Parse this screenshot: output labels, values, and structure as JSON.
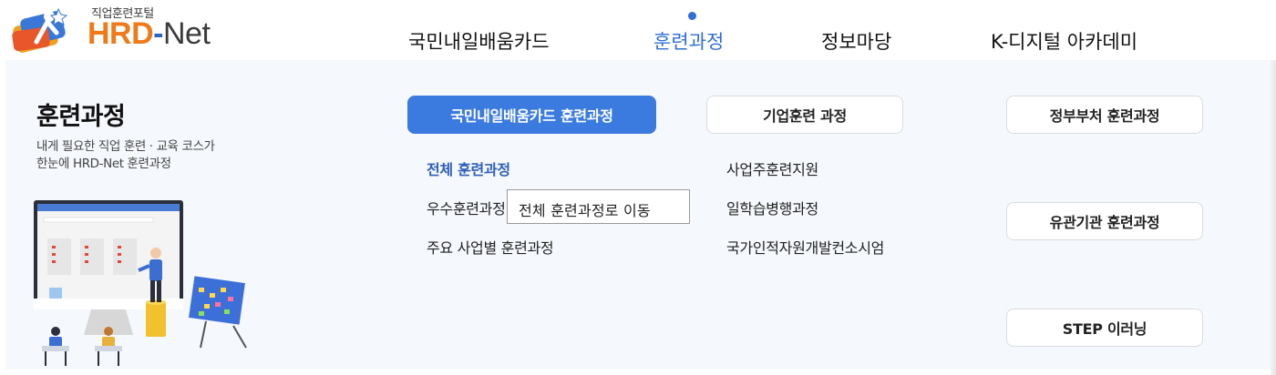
{
  "header": {
    "logo_sub": "직업훈련포털",
    "logo_hrd": "HRD",
    "logo_dash": "-",
    "logo_net": "Net",
    "nav": [
      {
        "label": "국민내일배움카드"
      },
      {
        "label": "훈련과정"
      },
      {
        "label": "정보마당"
      },
      {
        "label": "K-디지털 아카데미"
      }
    ]
  },
  "section": {
    "title": "훈련과정",
    "desc_line1": "내게 필요한 직업 훈련 · 교육 코스가",
    "desc_line2": "한눈에 HRD-Net 훈련과정"
  },
  "buttons": {
    "card_course": "국민내일배움카드 훈련과정",
    "company_course": "기업훈련 과정",
    "gov_course": "정부부처 훈련과정",
    "related_course": "유관기관 훈련과정",
    "step": "STEP 이러닝"
  },
  "links": {
    "all_courses": "전체 훈련과정",
    "excellent": "우수훈련과정",
    "major_business": "주요 사업별 훈련과정",
    "employer_support": "사업주훈련지원",
    "work_study": "일학습병행과정",
    "nqs": "국가인적자원개발컨소시엄"
  },
  "tooltip": "전체 훈련과정로 이동",
  "colors": {
    "accent": "#3b7be0",
    "active_nav": "#2f6fd6",
    "logo_orange": "#f07a1a",
    "panel_bg": "#f5f8fc"
  }
}
